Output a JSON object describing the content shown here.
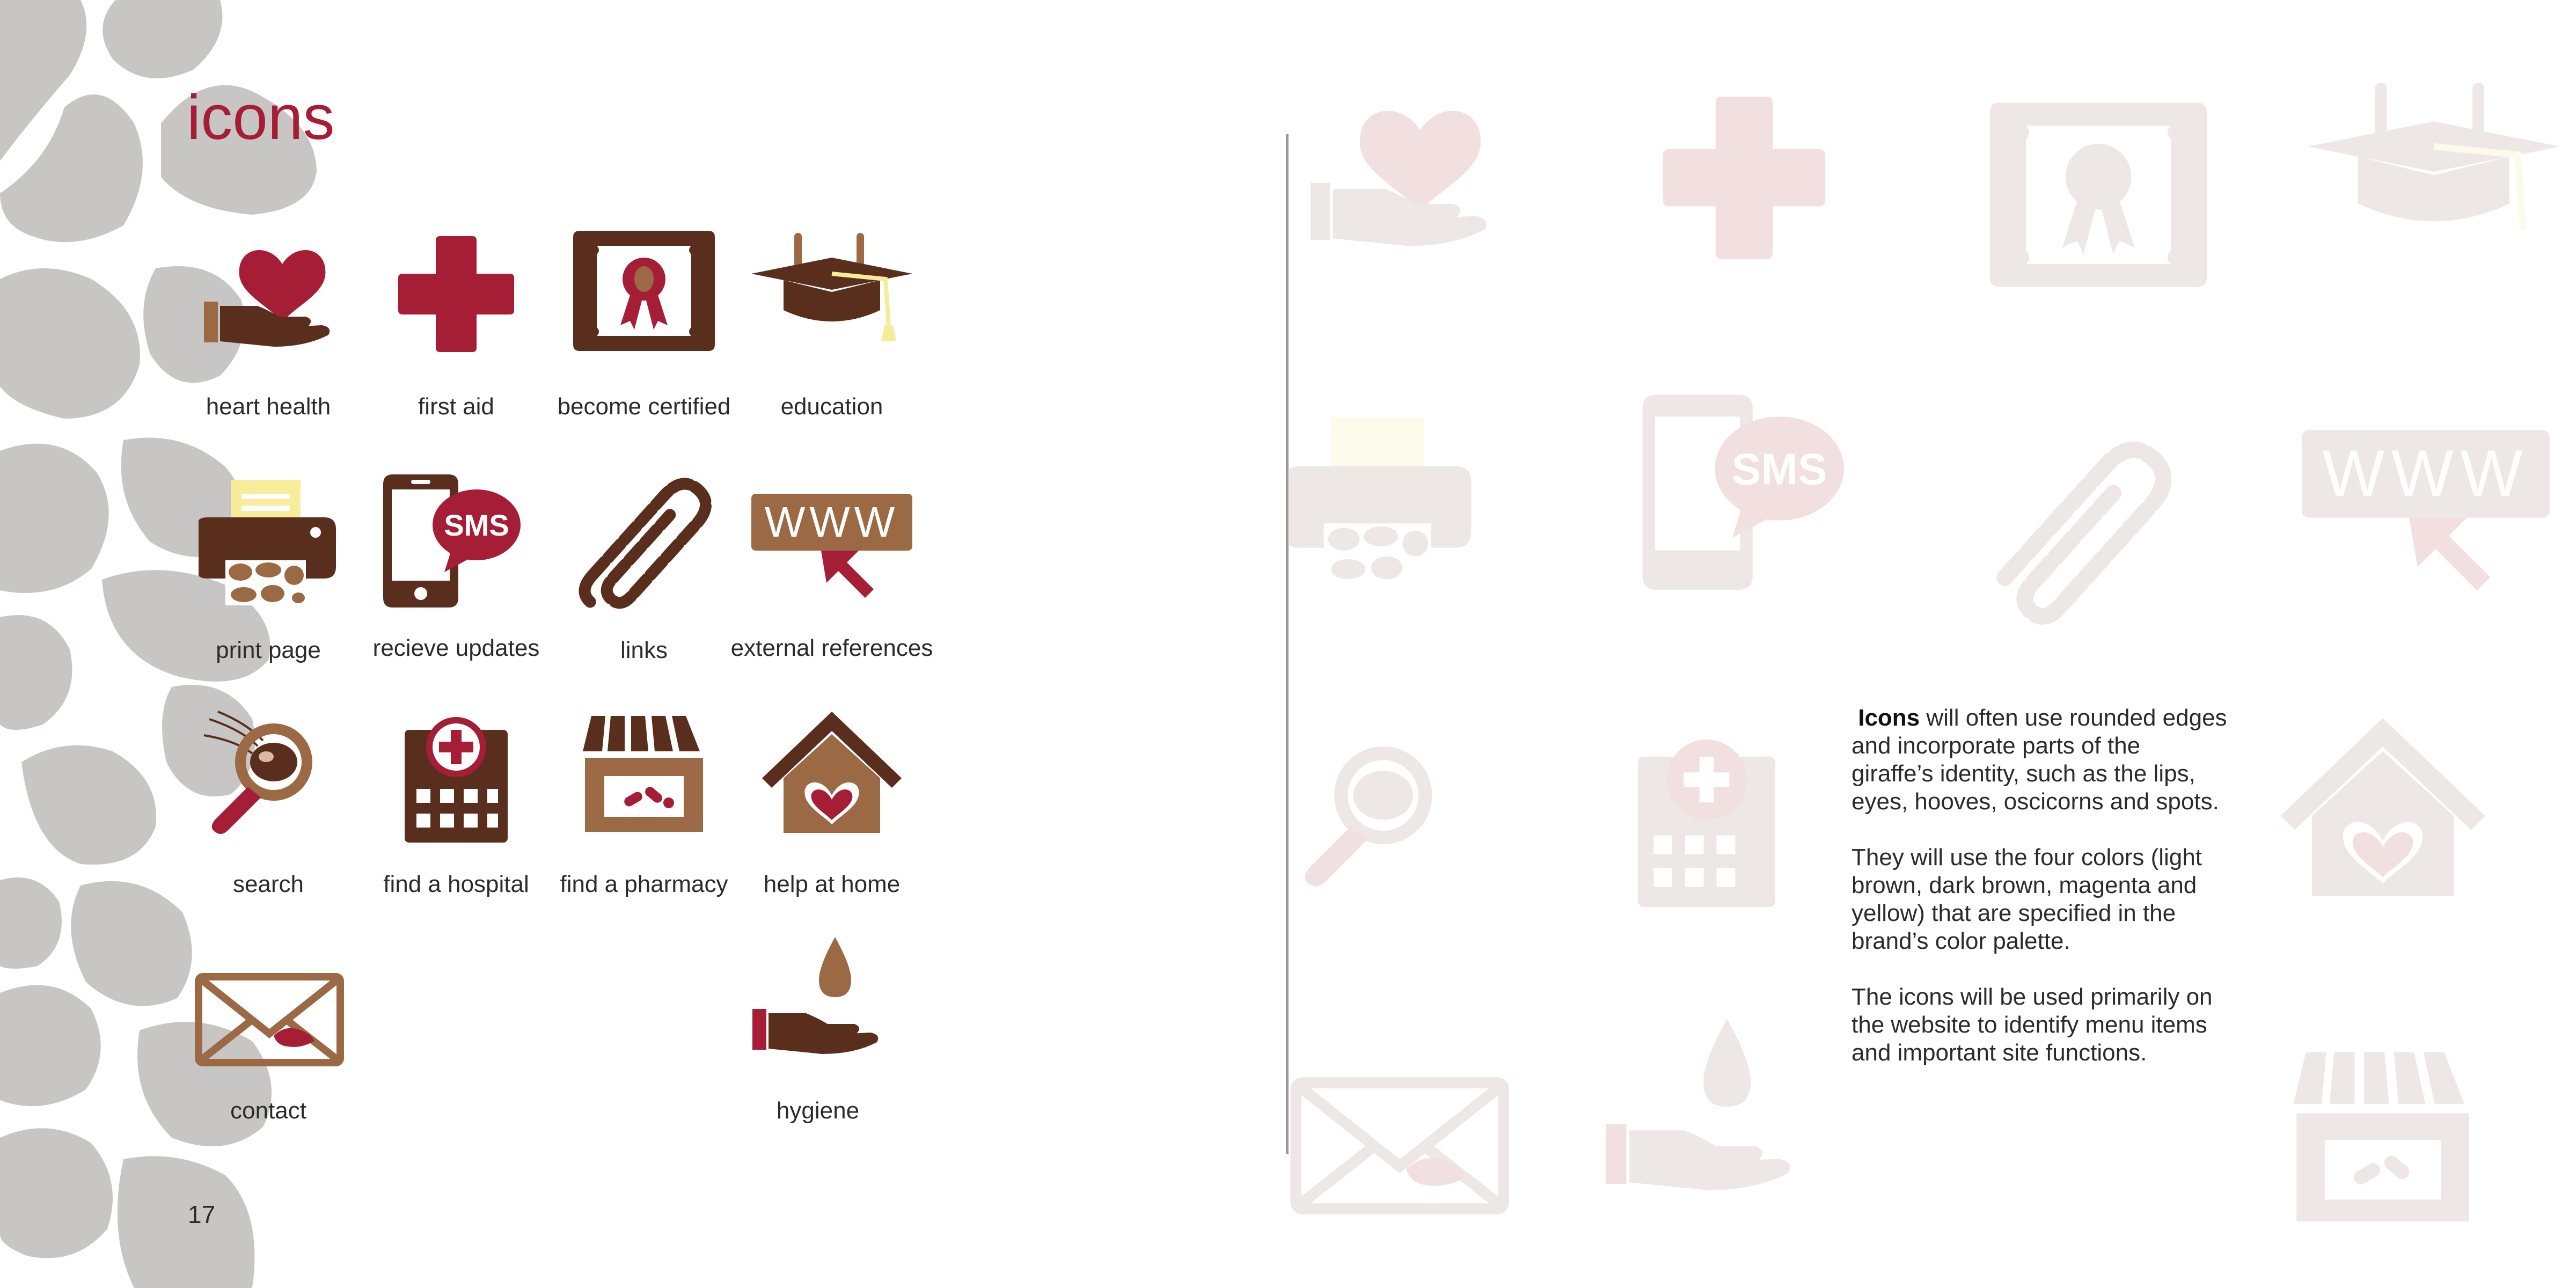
{
  "page": {
    "title": "icons",
    "page_number": "17"
  },
  "colors": {
    "magenta": "#a51e36",
    "dark_brown": "#5a2e1d",
    "light_brown": "#9b6a45",
    "yellow": "#f6ec9a",
    "spot_gray": "#c8c6c4",
    "ghost": "#efe6e1",
    "ghost_pink": "#f2dede"
  },
  "icons": [
    {
      "id": "heart-health",
      "label": "heart health",
      "icon": "hand-heart-icon"
    },
    {
      "id": "first-aid",
      "label": "first aid",
      "icon": "cross-icon"
    },
    {
      "id": "become-certified",
      "label": "become certified",
      "icon": "certificate-icon"
    },
    {
      "id": "education",
      "label": "education",
      "icon": "graduation-cap-icon"
    },
    {
      "id": "print-page",
      "label": "print page",
      "icon": "printer-icon"
    },
    {
      "id": "recieve-updates",
      "label": "recieve updates",
      "icon": "phone-sms-icon"
    },
    {
      "id": "links",
      "label": "links",
      "icon": "paperclip-icon"
    },
    {
      "id": "external-references",
      "label": "external references",
      "icon": "www-icon"
    },
    {
      "id": "search",
      "label": "search",
      "icon": "magnifier-eye-icon"
    },
    {
      "id": "find-a-hospital",
      "label": "find a hospital",
      "icon": "hospital-icon"
    },
    {
      "id": "find-a-pharmacy",
      "label": "find a pharmacy",
      "icon": "pharmacy-icon"
    },
    {
      "id": "help-at-home",
      "label": "help at home",
      "icon": "house-heart-icon"
    },
    {
      "id": "contact",
      "label": "contact",
      "icon": "envelope-icon"
    },
    {
      "id": "hygiene",
      "label": "hygiene",
      "icon": "hand-drop-icon"
    }
  ],
  "description": {
    "lead": "Icons",
    "p1_rest": " will often use rounded edges and incorporate parts of the giraffe’s identity, such as the lips, eyes, hooves, oscicorns and spots.",
    "p2": "They will use the four colors (light brown, dark brown, magenta and yellow) that are specified in the brand’s color palette.",
    "p3": "The icons will be used primarily on the website to identify menu items and important site functions."
  }
}
